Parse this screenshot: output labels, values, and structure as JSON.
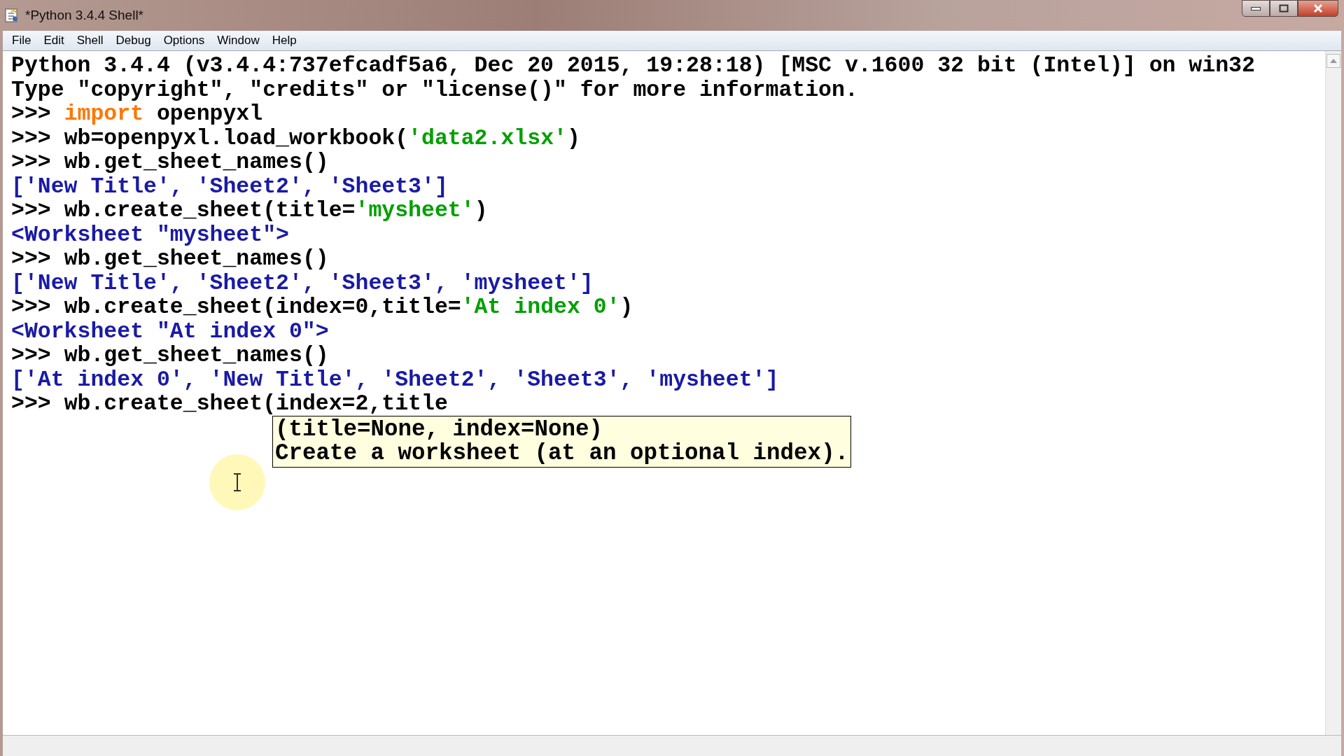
{
  "window": {
    "title": "*Python 3.4.4 Shell*"
  },
  "menu": [
    "File",
    "Edit",
    "Shell",
    "Debug",
    "Options",
    "Window",
    "Help"
  ],
  "shell_lines": [
    {
      "segments": [
        {
          "kind": "plain",
          "text": "Python 3.4.4 (v3.4.4:737efcadf5a6, Dec 20 2015, 19:28:18) [MSC v.1600 32 bit (Intel)] on win32"
        }
      ]
    },
    {
      "segments": [
        {
          "kind": "plain",
          "text": "Type \"copyright\", \"credits\" or \"license()\" for more information."
        }
      ]
    },
    {
      "segments": [
        {
          "kind": "prompt",
          "text": ">>> "
        },
        {
          "kind": "keyword",
          "text": "import"
        },
        {
          "kind": "plain",
          "text": " openpyxl"
        }
      ]
    },
    {
      "segments": [
        {
          "kind": "prompt",
          "text": ">>> "
        },
        {
          "kind": "plain",
          "text": "wb=openpyxl.load_workbook("
        },
        {
          "kind": "string",
          "text": "'data2.xlsx'"
        },
        {
          "kind": "plain",
          "text": ")"
        }
      ]
    },
    {
      "segments": [
        {
          "kind": "prompt",
          "text": ">>> "
        },
        {
          "kind": "plain",
          "text": "wb.get_sheet_names()"
        }
      ]
    },
    {
      "segments": [
        {
          "kind": "output",
          "text": "['New Title', 'Sheet2', 'Sheet3']"
        }
      ]
    },
    {
      "segments": [
        {
          "kind": "prompt",
          "text": ">>> "
        },
        {
          "kind": "plain",
          "text": "wb.create_sheet(title="
        },
        {
          "kind": "string",
          "text": "'mysheet'"
        },
        {
          "kind": "plain",
          "text": ")"
        }
      ]
    },
    {
      "segments": [
        {
          "kind": "output",
          "text": "<Worksheet \"mysheet\">"
        }
      ]
    },
    {
      "segments": [
        {
          "kind": "prompt",
          "text": ">>> "
        },
        {
          "kind": "plain",
          "text": "wb.get_sheet_names()"
        }
      ]
    },
    {
      "segments": [
        {
          "kind": "output",
          "text": "['New Title', 'Sheet2', 'Sheet3', 'mysheet']"
        }
      ]
    },
    {
      "segments": [
        {
          "kind": "prompt",
          "text": ">>> "
        },
        {
          "kind": "plain",
          "text": "wb.create_sheet(index=0,title="
        },
        {
          "kind": "string",
          "text": "'At index 0'"
        },
        {
          "kind": "plain",
          "text": ")"
        }
      ]
    },
    {
      "segments": [
        {
          "kind": "output",
          "text": "<Worksheet \"At index 0\">"
        }
      ]
    },
    {
      "segments": [
        {
          "kind": "prompt",
          "text": ">>> "
        },
        {
          "kind": "plain",
          "text": "wb.get_sheet_names()"
        }
      ]
    },
    {
      "segments": [
        {
          "kind": "output",
          "text": "['At index 0', 'New Title', 'Sheet2', 'Sheet3', 'mysheet']"
        }
      ]
    },
    {
      "segments": [
        {
          "kind": "prompt",
          "text": ">>> "
        },
        {
          "kind": "plain",
          "text": "wb.create_sheet(index=2,title"
        }
      ]
    }
  ],
  "calltip": {
    "lines": [
      "(title=None, index=None)",
      "Create a worksheet (at an optional index)."
    ]
  }
}
